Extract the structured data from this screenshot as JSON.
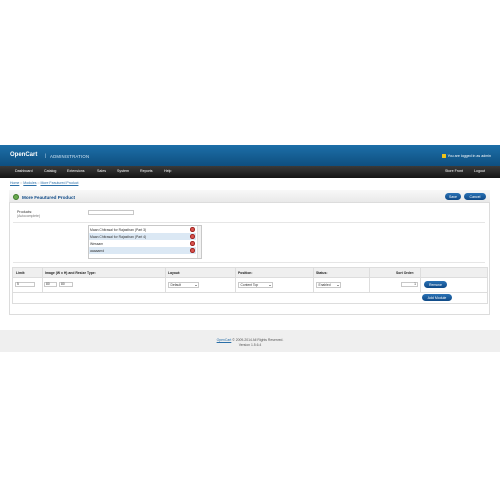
{
  "header": {
    "logo": "OpenCart",
    "separator": "|",
    "admin_label": "ADMINISTRATION",
    "login_status": "You are logged in as admin"
  },
  "menu": {
    "items": [
      "Dashboard",
      "Catalog",
      "Extensions",
      "Sales",
      "System",
      "Reports",
      "Help"
    ],
    "right_items": [
      "Store Front",
      "Logout"
    ]
  },
  "breadcrumb": {
    "items": [
      "Home",
      "Modules",
      "More Feautured Product"
    ],
    "separator": "::"
  },
  "page": {
    "title": "More Feautured Product",
    "save_label": "Save",
    "cancel_label": "Cancel"
  },
  "form": {
    "products_label": "Products:",
    "products_sub": "(Autocomplete)",
    "products_placeholder": "",
    "selected_products": [
      "Maan Chitrasal for Rajasthan (Part 3)",
      "Maan Chitrasal for Rajasthan (Part 4)",
      "Wessam",
      "aaaaamd"
    ]
  },
  "module_table": {
    "headers": [
      "Limit:",
      "Image (W x H) and Resize Type:",
      "Layout:",
      "Position:",
      "Status:",
      "Sort Order:"
    ],
    "row": {
      "limit": "5",
      "image_width": "80",
      "image_height": "80",
      "layout": "Default",
      "position": "Content Top",
      "status": "Enabled",
      "sort_order": "1",
      "remove_label": "Remove"
    },
    "add_module_label": "Add Module"
  },
  "footer": {
    "link": "OpenCart",
    "copyright": " © 2009-2014 All Rights Reserved.",
    "version": "Version 1.5.6.4"
  },
  "colors": {
    "header_blue": "#0e4f80",
    "menu_black": "#141414",
    "button_blue": "#0f4a87",
    "remove_red": "#d9534f"
  },
  "icons": {
    "lock": "lock-icon",
    "module": "module-icon",
    "remove": "remove-icon"
  }
}
